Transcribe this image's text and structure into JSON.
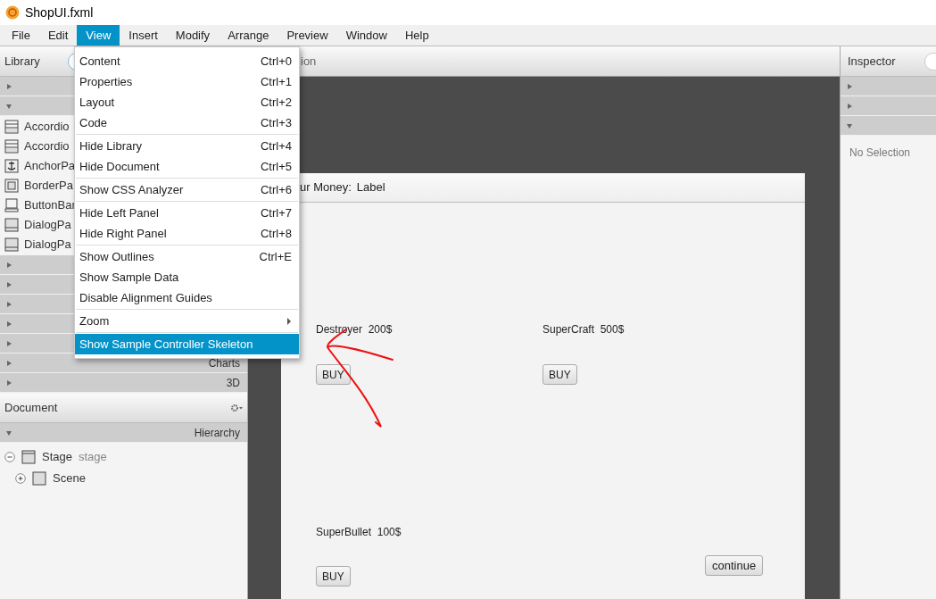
{
  "window": {
    "title": "ShopUI.fxml"
  },
  "menu_bar": [
    {
      "label": "File",
      "selected": false
    },
    {
      "label": "Edit",
      "selected": false
    },
    {
      "label": "View",
      "selected": true
    },
    {
      "label": "Insert",
      "selected": false
    },
    {
      "label": "Modify",
      "selected": false
    },
    {
      "label": "Arrange",
      "selected": false
    },
    {
      "label": "Preview",
      "selected": false
    },
    {
      "label": "Window",
      "selected": false
    },
    {
      "label": "Help",
      "selected": false
    }
  ],
  "view_menu": {
    "groups": [
      [
        {
          "kind": "command",
          "label": "Content",
          "shortcut": "Ctrl+0",
          "selected": false
        },
        {
          "kind": "command",
          "label": "Properties",
          "shortcut": "Ctrl+1",
          "selected": false
        },
        {
          "kind": "command",
          "label": "Layout",
          "shortcut": "Ctrl+2",
          "selected": false
        },
        {
          "kind": "command",
          "label": "Code",
          "shortcut": "Ctrl+3",
          "selected": false
        }
      ],
      [
        {
          "kind": "command",
          "label": "Hide Library",
          "shortcut": "Ctrl+4",
          "selected": false
        },
        {
          "kind": "command",
          "label": "Hide Document",
          "shortcut": "Ctrl+5",
          "selected": false
        }
      ],
      [
        {
          "kind": "command",
          "label": "Show CSS Analyzer",
          "shortcut": "Ctrl+6",
          "selected": false
        }
      ],
      [
        {
          "kind": "command",
          "label": "Hide Left Panel",
          "shortcut": "Ctrl+7",
          "selected": false
        },
        {
          "kind": "command",
          "label": "Hide Right Panel",
          "shortcut": "Ctrl+8",
          "selected": false
        }
      ],
      [
        {
          "kind": "command",
          "label": "Show Outlines",
          "shortcut": "Ctrl+E",
          "selected": false
        },
        {
          "kind": "command",
          "label": "Show Sample Data",
          "selected": false
        },
        {
          "kind": "command",
          "label": "Disable Alignment Guides",
          "selected": false
        }
      ],
      [
        {
          "kind": "submenu",
          "label": "Zoom",
          "selected": false
        }
      ],
      [
        {
          "kind": "command",
          "label": "Show Sample Controller Skeleton",
          "selected": true
        }
      ]
    ]
  },
  "library": {
    "title": "Library",
    "top_sections": [
      {
        "expanded": false
      },
      {
        "expanded": true
      }
    ],
    "items": [
      {
        "kind": "accordion",
        "label": "Accordio"
      },
      {
        "kind": "accordion",
        "label": "Accordio"
      },
      {
        "kind": "anchor",
        "label": "AnchorPa"
      },
      {
        "kind": "border",
        "label": "BorderPa"
      },
      {
        "kind": "buttonbar",
        "label": "ButtonBar"
      },
      {
        "kind": "dialog",
        "label": "DialogPa"
      },
      {
        "kind": "dialog",
        "label": "DialogPa"
      }
    ],
    "lower_sections": [
      {
        "expanded": false
      },
      {
        "expanded": false
      },
      {
        "expanded": false
      },
      {
        "expanded": false
      },
      {
        "expanded": false
      },
      {
        "label": "Charts",
        "expanded": false
      },
      {
        "label": "3D",
        "expanded": false
      }
    ]
  },
  "document": {
    "title": "Document",
    "hierarchy": {
      "label": "Hierarchy",
      "expanded": true
    },
    "tree": [
      {
        "label": "Stage",
        "type_label": "stage",
        "expanded": true,
        "children": [
          {
            "label": "Scene",
            "expanded": false
          }
        ]
      }
    ]
  },
  "content": {
    "toolbar_text": "ion",
    "form": {
      "money_label": "ur Money:",
      "money_value": "Label",
      "products": [
        {
          "label": "Destroyer  200$",
          "button": "BUY"
        },
        {
          "label": "SuperCraft  500$",
          "button": "BUY"
        },
        {
          "label": "SuperBullet  100$",
          "button": "BUY"
        }
      ],
      "continue_button": "continue"
    }
  },
  "inspector": {
    "title": "Inspector",
    "sections": [
      {
        "expanded": false
      },
      {
        "expanded": false
      },
      {
        "expanded": true
      }
    ],
    "empty_text": "No Selection"
  }
}
